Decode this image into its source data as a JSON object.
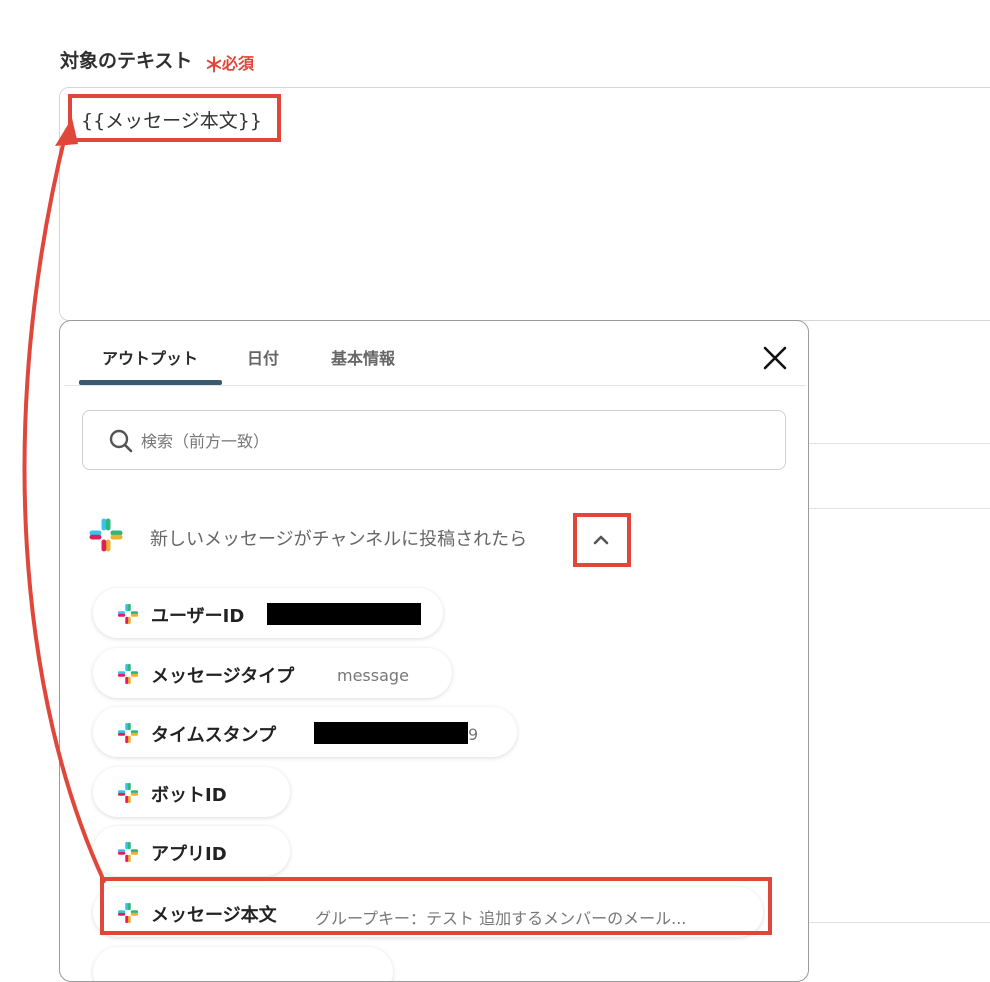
{
  "field": {
    "label": "対象のテキスト",
    "required_mark": "＊",
    "required_text": "必須",
    "value": "{{メッセージ本文}}"
  },
  "popup": {
    "tabs": [
      {
        "label": "アウトプット",
        "active": true
      },
      {
        "label": "日付",
        "active": false
      },
      {
        "label": "基本情報",
        "active": false
      }
    ],
    "close_icon": "close-icon",
    "search_placeholder": "検索（前方一致）",
    "section": {
      "title": "新しいメッセージがチャンネルに投稿されたら",
      "icon": "slack-icon",
      "toggle_icon": "chevron-up-icon"
    },
    "items": [
      {
        "label": "ユーザーID",
        "value": "",
        "redacted": true
      },
      {
        "label": "メッセージタイプ",
        "value": "message",
        "redacted": false
      },
      {
        "label": "タイムスタンプ",
        "value": "9",
        "redacted": true
      },
      {
        "label": "ボットID",
        "value": "",
        "redacted": false
      },
      {
        "label": "アプリID",
        "value": "",
        "redacted": false
      },
      {
        "label": "メッセージ本文",
        "value": "グループキー：テスト 追加するメンバーのメール...",
        "redacted": false
      }
    ]
  },
  "colors": {
    "accent_red": "#e0473a",
    "tab_underline": "#3a5a6e",
    "slack_blue": "#36c5f0",
    "slack_green": "#2eb67d",
    "slack_yellow": "#ecb22e",
    "slack_red": "#e01e5a"
  }
}
